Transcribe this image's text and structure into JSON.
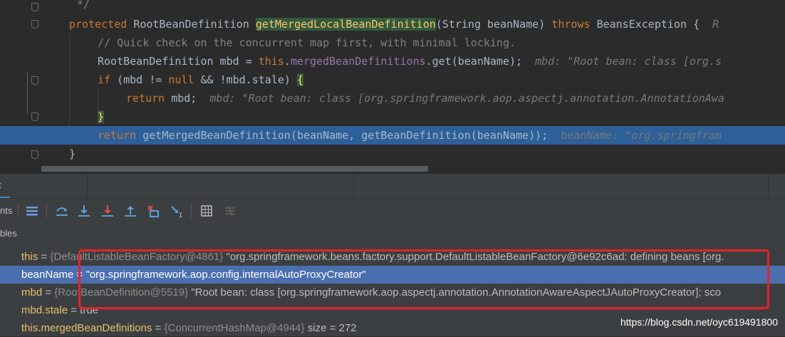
{
  "editor": {
    "lines": [
      {
        "comment_close": "*/"
      },
      {
        "kw_protected": "protected",
        "type_name": "RootBeanDefinition",
        "method": "getMergedLocalBeanDefinition",
        "params": "(String beanName)",
        "kw_throws": "throws",
        "exc": "BeansException {",
        "tail": "R"
      },
      {
        "comment": "// Quick check on the concurrent map first, with minimal locking."
      },
      {
        "decl": "RootBeanDefinition mbd = ",
        "kw_this": "this",
        "dot": ".",
        "field": "mergedBeanDefinitions",
        "call": ".get(beanName);",
        "inline": "mbd: \"Root bean: class [org.s"
      },
      {
        "kw_if": "if",
        "cond_a": " (mbd != ",
        "kw_null": "null",
        "cond_b": " && !mbd.stale) ",
        "brace": "{"
      },
      {
        "kw_return": "return",
        "ret": " mbd;",
        "inline": "mbd: \"Root bean: class [org.springframework.aop.aspectj.annotation.AnnotationAwa"
      },
      {
        "brace": "}"
      },
      {
        "kw_return": "return",
        "call": " getMergedBeanDefinition(beanName, getBeanDefinition(beanName));",
        "inline": "beanName: \"org.springfram"
      },
      {
        "brace": "}"
      }
    ]
  },
  "debug": {
    "tab_label": "t",
    "toolbar_label": "nts",
    "vars_header": "bles",
    "buttons": [
      "menu-icon",
      "step-over-icon",
      "step-into-icon",
      "force-step-into-icon",
      "step-out-icon",
      "drop-frame-icon",
      "run-to-cursor-icon",
      "evaluate-icon",
      "trace-icon"
    ],
    "variables": [
      {
        "name": "this",
        "eq": " = ",
        "type": "{DefaultListableBeanFactory@4861}",
        "value": " \"org.springframework.beans.factory.support.DefaultListableBeanFactory@6e92c6ad: defining beans [org."
      },
      {
        "name": "beanName",
        "eq": " = ",
        "value": "\"org.springframework.aop.config.internalAutoProxyCreator\""
      },
      {
        "name": "mbd",
        "eq": " = ",
        "type": "{RootBeanDefinition@5519}",
        "value": " \"Root bean: class [org.springframework.aop.aspectj.annotation.AnnotationAwareAspectJAutoProxyCreator]; sco"
      },
      {
        "name": "mbd.stale",
        "eq": " = ",
        "value": "true"
      },
      {
        "name": "this.mergedBeanDefinitions",
        "eq": " = ",
        "type": "{ConcurrentHashMap@4944}",
        "value": " size = 272"
      }
    ]
  },
  "watermark": "https://blog.csdn.net/oyc619491800",
  "colors": {
    "highlight_box": "#e8202a",
    "selection": "#4b6eaf",
    "current_line": "#2d6099"
  }
}
